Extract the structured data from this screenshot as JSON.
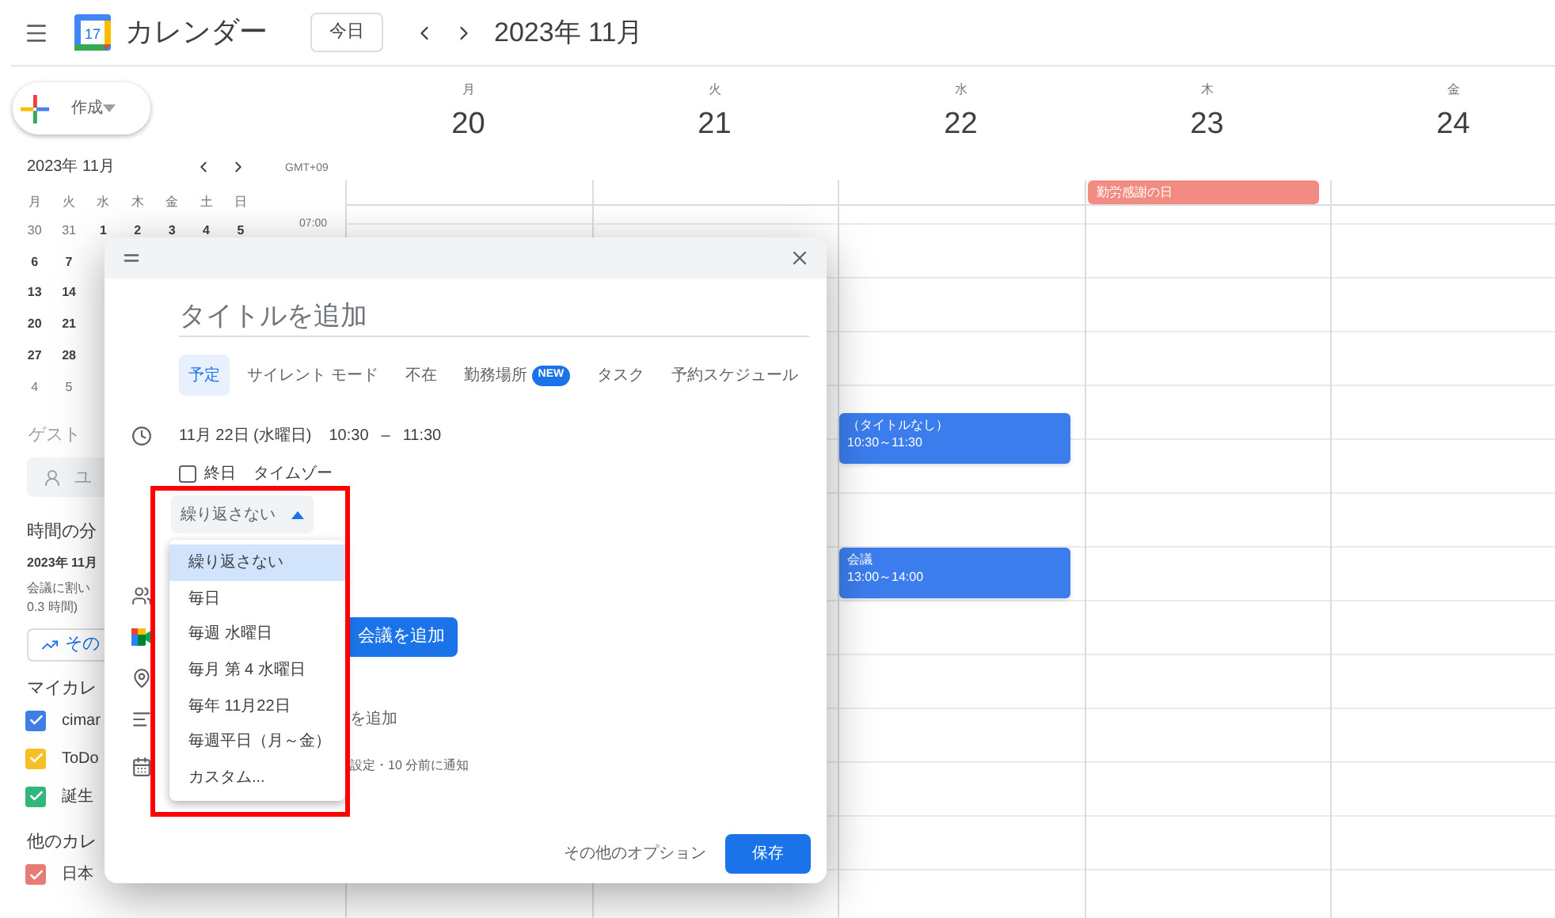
{
  "header": {
    "logo_text": "17",
    "app_title": "カレンダー",
    "today_button": "今日",
    "period": "2023年 11月"
  },
  "sidebar": {
    "create_button": "作成",
    "mini_calendar": {
      "title": "2023年 11月",
      "weekdays": [
        "月",
        "火",
        "水",
        "木",
        "金",
        "土",
        "日"
      ],
      "weeks": [
        [
          {
            "day": "30",
            "in_month": false
          },
          {
            "day": "31",
            "in_month": false
          },
          {
            "day": "1",
            "in_month": true
          },
          {
            "day": "2",
            "in_month": true
          },
          {
            "day": "3",
            "in_month": true
          },
          {
            "day": "4",
            "in_month": true
          },
          {
            "day": "5",
            "in_month": true
          }
        ],
        [
          {
            "day": "6",
            "in_month": true
          },
          {
            "day": "7",
            "in_month": true
          }
        ],
        [
          {
            "day": "13",
            "in_month": true
          },
          {
            "day": "14",
            "in_month": true
          }
        ],
        [
          {
            "day": "20",
            "in_month": true
          },
          {
            "day": "21",
            "in_month": true
          }
        ],
        [
          {
            "day": "27",
            "in_month": true
          },
          {
            "day": "28",
            "in_month": true
          }
        ],
        [
          {
            "day": "4",
            "in_month": false
          },
          {
            "day": "5",
            "in_month": false
          }
        ]
      ]
    },
    "guests_label": "ゲスト",
    "guests_placeholder": "ユ",
    "insights": {
      "title": "時間の分",
      "period": "2023年 11月",
      "text_1": "会議に割い",
      "text_2": "0.3 時間)",
      "button": "その"
    },
    "my_calendars_label": "マイカレ",
    "my_calendars": [
      {
        "name": "cimar",
        "checked": true,
        "color": "#3f7ee8"
      },
      {
        "name": "ToDo",
        "checked": true,
        "color": "#f6bf26"
      },
      {
        "name": "誕生",
        "checked": true,
        "color": "#33b679"
      }
    ],
    "other_calendars_label": "他のカレ",
    "other_calendars": [
      {
        "name": "日本",
        "checked": true,
        "color": "#e67c73"
      }
    ]
  },
  "week_view": {
    "timezone": "GMT+09",
    "time_labels": [
      "07:00"
    ],
    "days": [
      {
        "weekday": "月",
        "date": "20"
      },
      {
        "weekday": "火",
        "date": "21"
      },
      {
        "weekday": "水",
        "date": "22",
        "events": [
          {
            "title": "（タイトルなし）",
            "time": "10:30～11:30",
            "color": "#3b7ded"
          },
          {
            "title": "会議",
            "time": "13:00～14:00",
            "color": "#3b7ded"
          }
        ]
      },
      {
        "weekday": "木",
        "date": "23",
        "all_day_events": [
          {
            "title": "勤労感謝の日",
            "color": "#f28b82"
          }
        ]
      },
      {
        "weekday": "金",
        "date": "24"
      }
    ]
  },
  "dialog": {
    "title_placeholder": "タイトルを追加",
    "tabs": [
      {
        "label": "予定",
        "selected": true
      },
      {
        "label": "サイレント モード",
        "selected": false
      },
      {
        "label": "不在",
        "selected": false
      },
      {
        "label": "勤務場所",
        "selected": false,
        "badge": "NEW"
      },
      {
        "label": "タスク",
        "selected": false
      },
      {
        "label": "予約スケジュール",
        "selected": false
      }
    ],
    "date": "11月 22日 (水曜日)",
    "start_time": "10:30",
    "dash": "–",
    "end_time": "11:30",
    "all_day": {
      "label": "終日",
      "checked": false
    },
    "timezone_link": "タイムゾー",
    "repeat_select": {
      "value": "繰り返さない",
      "expanded": true
    },
    "repeat_options": [
      {
        "label": "繰り返さない",
        "selected": true
      },
      {
        "label": "毎日",
        "selected": false
      },
      {
        "label": "毎週 水曜日",
        "selected": false
      },
      {
        "label": "毎月 第 4 水曜日",
        "selected": false
      },
      {
        "label": "毎年 11月22日",
        "selected": false
      },
      {
        "label": "毎週平日（月～金）",
        "selected": false
      },
      {
        "label": "カスタム...",
        "selected": false
      }
    ],
    "meet_button": "会議を追加",
    "description_text": "を追加",
    "notification_text": "設定・10 分前に通知",
    "more_options": "その他のオプション",
    "save_button": "保存"
  }
}
